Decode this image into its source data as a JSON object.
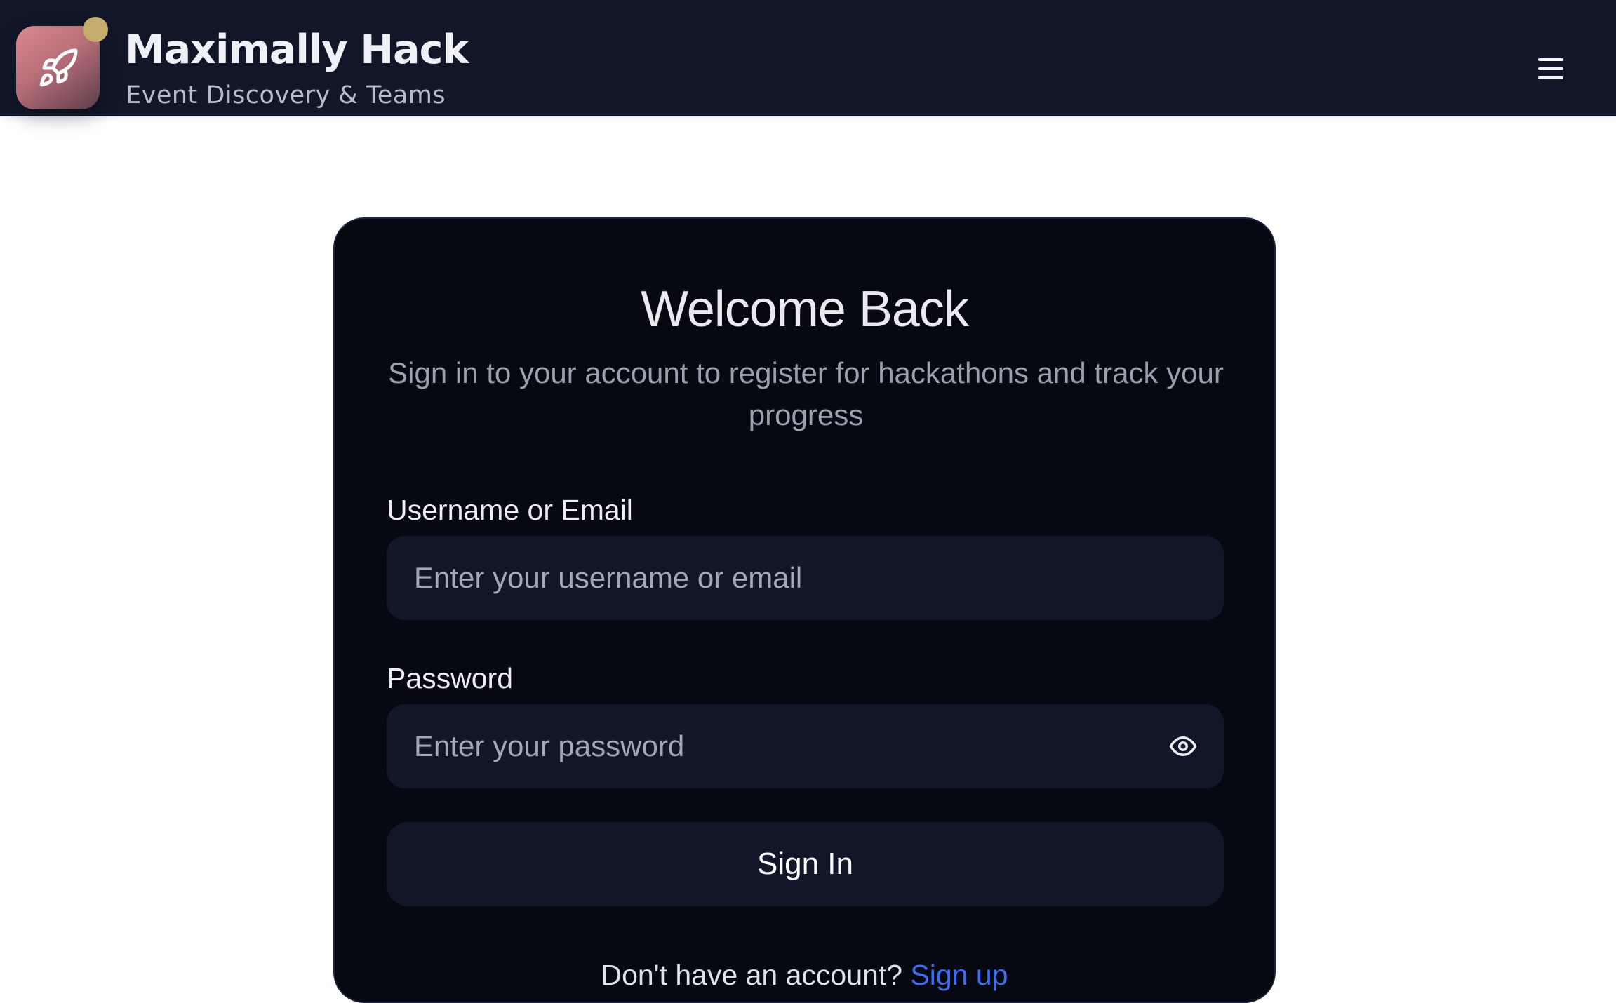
{
  "header": {
    "brand_title": "Maximally Hack",
    "brand_subtitle": "Event Discovery & Teams",
    "logo_icon": "rocket-icon",
    "menu_icon": "hamburger-menu-icon"
  },
  "login": {
    "title": "Welcome Back",
    "subtitle": "Sign in to your account to register for hackathons and track your progress",
    "username_label": "Username or Email",
    "username_placeholder": "Enter your username or email",
    "username_value": "",
    "password_label": "Password",
    "password_placeholder": "Enter your password",
    "password_value": "",
    "password_toggle_icon": "eye-icon",
    "submit_label": "Sign In",
    "signup_prompt": "Don't have an account?",
    "signup_link": "Sign up"
  },
  "colors": {
    "header_bg": "#111729",
    "card_bg": "#060912",
    "input_bg": "#111729",
    "link": "#3b6ef5",
    "logo_gradient_start": "#d98a8f",
    "logo_gradient_end": "#5c3e4b",
    "logo_dot": "#c4ac6c"
  }
}
